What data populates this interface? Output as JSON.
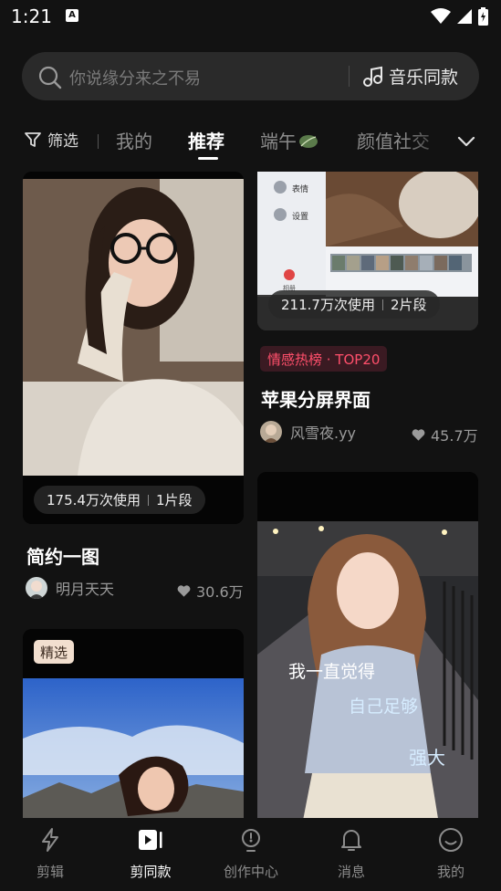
{
  "status_bar": {
    "time": "1:21",
    "notif_letter": "A"
  },
  "search": {
    "placeholder": "你说缘分来之不易",
    "music_label": "音乐同款"
  },
  "tabs": {
    "filter_label": "筛选",
    "items": [
      {
        "label": "我的",
        "active": false
      },
      {
        "label": "推荐",
        "active": true
      },
      {
        "label": "端午",
        "active": false
      },
      {
        "label": "颜值社交",
        "active": false
      }
    ]
  },
  "feed": {
    "cards": [
      {
        "id": "c1",
        "usage": "175.4万次使用",
        "segments": "1片段",
        "title": "简约一图",
        "author": "明月天天",
        "likes": "30.6万"
      },
      {
        "id": "c2",
        "usage": "211.7万次使用",
        "segments": "2片段",
        "badge": "情感热榜 · TOP20",
        "title": "苹果分屏界面",
        "author": "风雪夜.yy",
        "likes": "45.7万",
        "screenshot_labels": {
          "item1": "表情",
          "item2": "设置",
          "side": "相册"
        }
      },
      {
        "id": "c3",
        "tag": "精选"
      },
      {
        "id": "c4",
        "overlay_text": {
          "line1": "我一直觉得",
          "line2": "自己足够",
          "line3": "强大"
        }
      }
    ]
  },
  "bottom_nav": [
    {
      "label": "剪辑",
      "icon": "lightning-icon",
      "active": false
    },
    {
      "label": "剪同款",
      "icon": "play-clip-icon",
      "active": true
    },
    {
      "label": "创作中心",
      "icon": "lightbulb-icon",
      "active": false
    },
    {
      "label": "消息",
      "icon": "bell-icon",
      "active": false
    },
    {
      "label": "我的",
      "icon": "smile-icon",
      "active": false
    }
  ]
}
